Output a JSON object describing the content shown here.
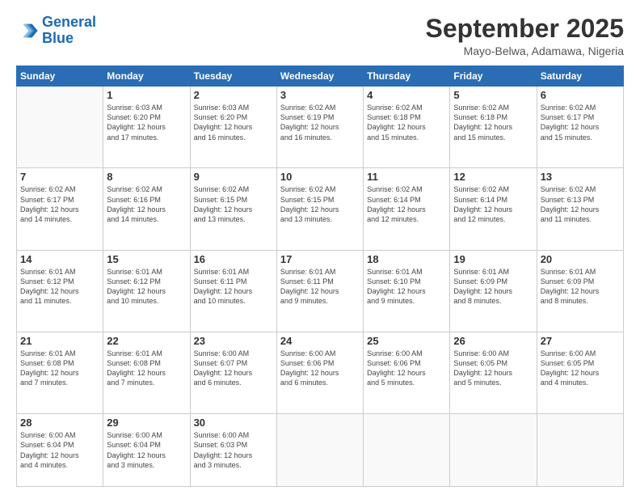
{
  "header": {
    "logo_line1": "General",
    "logo_line2": "Blue",
    "month_title": "September 2025",
    "location": "Mayo-Belwa, Adamawa, Nigeria"
  },
  "days_of_week": [
    "Sunday",
    "Monday",
    "Tuesday",
    "Wednesday",
    "Thursday",
    "Friday",
    "Saturday"
  ],
  "weeks": [
    [
      {
        "day": "",
        "info": ""
      },
      {
        "day": "1",
        "info": "Sunrise: 6:03 AM\nSunset: 6:20 PM\nDaylight: 12 hours\nand 17 minutes."
      },
      {
        "day": "2",
        "info": "Sunrise: 6:03 AM\nSunset: 6:20 PM\nDaylight: 12 hours\nand 16 minutes."
      },
      {
        "day": "3",
        "info": "Sunrise: 6:02 AM\nSunset: 6:19 PM\nDaylight: 12 hours\nand 16 minutes."
      },
      {
        "day": "4",
        "info": "Sunrise: 6:02 AM\nSunset: 6:18 PM\nDaylight: 12 hours\nand 15 minutes."
      },
      {
        "day": "5",
        "info": "Sunrise: 6:02 AM\nSunset: 6:18 PM\nDaylight: 12 hours\nand 15 minutes."
      },
      {
        "day": "6",
        "info": "Sunrise: 6:02 AM\nSunset: 6:17 PM\nDaylight: 12 hours\nand 15 minutes."
      }
    ],
    [
      {
        "day": "7",
        "info": "Sunrise: 6:02 AM\nSunset: 6:17 PM\nDaylight: 12 hours\nand 14 minutes."
      },
      {
        "day": "8",
        "info": "Sunrise: 6:02 AM\nSunset: 6:16 PM\nDaylight: 12 hours\nand 14 minutes."
      },
      {
        "day": "9",
        "info": "Sunrise: 6:02 AM\nSunset: 6:15 PM\nDaylight: 12 hours\nand 13 minutes."
      },
      {
        "day": "10",
        "info": "Sunrise: 6:02 AM\nSunset: 6:15 PM\nDaylight: 12 hours\nand 13 minutes."
      },
      {
        "day": "11",
        "info": "Sunrise: 6:02 AM\nSunset: 6:14 PM\nDaylight: 12 hours\nand 12 minutes."
      },
      {
        "day": "12",
        "info": "Sunrise: 6:02 AM\nSunset: 6:14 PM\nDaylight: 12 hours\nand 12 minutes."
      },
      {
        "day": "13",
        "info": "Sunrise: 6:02 AM\nSunset: 6:13 PM\nDaylight: 12 hours\nand 11 minutes."
      }
    ],
    [
      {
        "day": "14",
        "info": "Sunrise: 6:01 AM\nSunset: 6:12 PM\nDaylight: 12 hours\nand 11 minutes."
      },
      {
        "day": "15",
        "info": "Sunrise: 6:01 AM\nSunset: 6:12 PM\nDaylight: 12 hours\nand 10 minutes."
      },
      {
        "day": "16",
        "info": "Sunrise: 6:01 AM\nSunset: 6:11 PM\nDaylight: 12 hours\nand 10 minutes."
      },
      {
        "day": "17",
        "info": "Sunrise: 6:01 AM\nSunset: 6:11 PM\nDaylight: 12 hours\nand 9 minutes."
      },
      {
        "day": "18",
        "info": "Sunrise: 6:01 AM\nSunset: 6:10 PM\nDaylight: 12 hours\nand 9 minutes."
      },
      {
        "day": "19",
        "info": "Sunrise: 6:01 AM\nSunset: 6:09 PM\nDaylight: 12 hours\nand 8 minutes."
      },
      {
        "day": "20",
        "info": "Sunrise: 6:01 AM\nSunset: 6:09 PM\nDaylight: 12 hours\nand 8 minutes."
      }
    ],
    [
      {
        "day": "21",
        "info": "Sunrise: 6:01 AM\nSunset: 6:08 PM\nDaylight: 12 hours\nand 7 minutes."
      },
      {
        "day": "22",
        "info": "Sunrise: 6:01 AM\nSunset: 6:08 PM\nDaylight: 12 hours\nand 7 minutes."
      },
      {
        "day": "23",
        "info": "Sunrise: 6:00 AM\nSunset: 6:07 PM\nDaylight: 12 hours\nand 6 minutes."
      },
      {
        "day": "24",
        "info": "Sunrise: 6:00 AM\nSunset: 6:06 PM\nDaylight: 12 hours\nand 6 minutes."
      },
      {
        "day": "25",
        "info": "Sunrise: 6:00 AM\nSunset: 6:06 PM\nDaylight: 12 hours\nand 5 minutes."
      },
      {
        "day": "26",
        "info": "Sunrise: 6:00 AM\nSunset: 6:05 PM\nDaylight: 12 hours\nand 5 minutes."
      },
      {
        "day": "27",
        "info": "Sunrise: 6:00 AM\nSunset: 6:05 PM\nDaylight: 12 hours\nand 4 minutes."
      }
    ],
    [
      {
        "day": "28",
        "info": "Sunrise: 6:00 AM\nSunset: 6:04 PM\nDaylight: 12 hours\nand 4 minutes."
      },
      {
        "day": "29",
        "info": "Sunrise: 6:00 AM\nSunset: 6:04 PM\nDaylight: 12 hours\nand 3 minutes."
      },
      {
        "day": "30",
        "info": "Sunrise: 6:00 AM\nSunset: 6:03 PM\nDaylight: 12 hours\nand 3 minutes."
      },
      {
        "day": "",
        "info": ""
      },
      {
        "day": "",
        "info": ""
      },
      {
        "day": "",
        "info": ""
      },
      {
        "day": "",
        "info": ""
      }
    ]
  ]
}
